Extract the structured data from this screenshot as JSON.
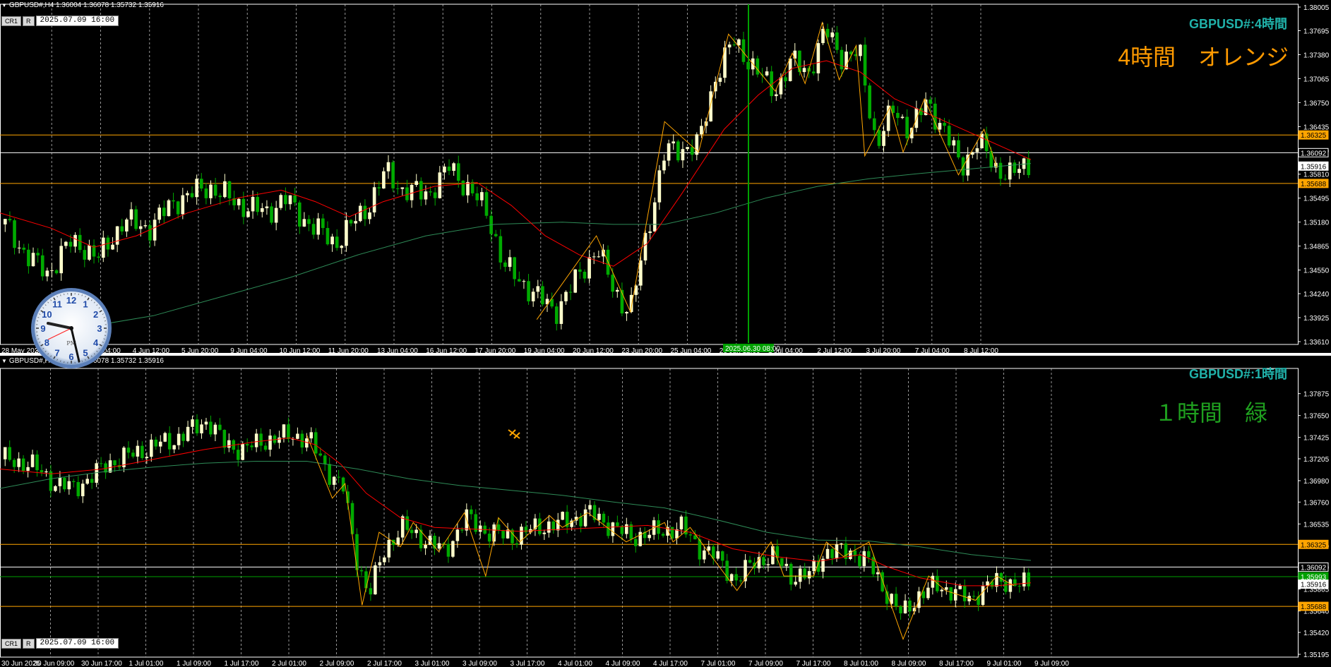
{
  "colors": {
    "background": "#000000",
    "bull_candle": "#ffffcc",
    "bear_candle": "#00aa00",
    "ma_fast": "#ff0000",
    "ma_slow": "#2e8b57",
    "zigzag": "#ffa500",
    "level_orange": "#ffa500",
    "level_white": "#ffffff",
    "cursor_line": "#00a000",
    "symbol_label_h4": "#20b2aa",
    "big_label_h4": "#ff9a00",
    "symbol_label_h1": "#20b2aa",
    "big_label_h1": "#1fa01f"
  },
  "toolbar": {
    "cr1_label": "CR1",
    "r_label": "R"
  },
  "chart_data": [
    {
      "type": "candlestick",
      "timeframe": "H4",
      "header": "GBPUSD#,H4  1.36004 1.36078 1.35732 1.35916",
      "date_box": "2025.07.09 16:00",
      "symbol_label": "GBPUSD#:4時間",
      "big_label": "4時間　オレンジ",
      "ylim": [
        1.3361,
        1.38005
      ],
      "price_ticks": [
        "1.38005",
        "1.37695",
        "1.37380",
        "1.37065",
        "1.36750",
        "1.36435",
        "1.36120",
        "1.35810",
        "1.35495",
        "1.35180",
        "1.34865",
        "1.34550",
        "1.34240",
        "1.33925",
        "1.33610"
      ],
      "price_tags": [
        {
          "value": "1.36325",
          "kind": "orange"
        },
        {
          "value": "1.36092",
          "kind": "white"
        },
        {
          "value": "1.35916",
          "kind": "current"
        },
        {
          "value": "1.35688",
          "kind": "orange"
        }
      ],
      "time_ticks": [
        "28 May 2025",
        "30 May 20:00",
        "3 Jun 04:00",
        "4 Jun 12:00",
        "5 Jun 20:00",
        "9 Jun 04:00",
        "10 Jun 12:00",
        "11 Jun 20:00",
        "13 Jun 04:00",
        "16 Jun 12:00",
        "17 Jun 20:00",
        "19 Jun 04:00",
        "20 Jun 12:00",
        "23 Jun 20:00",
        "25 Jun 04:00",
        "26 Jun 12:00",
        "1 Jul 04:00",
        "2 Jul 12:00",
        "3 Jul 20:00",
        "7 Jul 04:00",
        "8 Jul 12:00"
      ],
      "cursor_time": "2025.06.30 08:00",
      "levels": [
        1.36325,
        1.36092,
        1.35688
      ],
      "anchors": [
        [
          0,
          1.3515
        ],
        [
          0.025,
          1.3475
        ],
        [
          0.05,
          1.345
        ],
        [
          0.075,
          1.349
        ],
        [
          0.09,
          1.3488
        ],
        [
          0.11,
          1.347
        ],
        [
          0.14,
          1.352
        ],
        [
          0.17,
          1.351
        ],
        [
          0.2,
          1.3545
        ],
        [
          0.24,
          1.3565
        ],
        [
          0.28,
          1.354
        ],
        [
          0.31,
          1.353
        ],
        [
          0.33,
          1.355
        ],
        [
          0.35,
          1.3525
        ],
        [
          0.39,
          1.349
        ],
        [
          0.43,
          1.354
        ],
        [
          0.45,
          1.3585
        ],
        [
          0.47,
          1.356
        ],
        [
          0.5,
          1.3555
        ],
        [
          0.525,
          1.359
        ],
        [
          0.55,
          1.356
        ],
        [
          0.57,
          1.353
        ],
        [
          0.59,
          1.346
        ],
        [
          0.61,
          1.344
        ],
        [
          0.63,
          1.342
        ],
        [
          0.65,
          1.34
        ],
        [
          0.68,
          1.345
        ],
        [
          0.7,
          1.3485
        ],
        [
          0.715,
          1.344
        ],
        [
          0.73,
          1.341
        ],
        [
          0.74,
          1.3405
        ],
        [
          0.76,
          1.351
        ],
        [
          0.78,
          1.361
        ],
        [
          0.8,
          1.3615
        ],
        [
          0.82,
          1.362
        ],
        [
          0.84,
          1.371
        ],
        [
          0.86,
          1.3755
        ],
        [
          0.88,
          1.373
        ],
        [
          0.9,
          1.37
        ],
        [
          0.91,
          1.369
        ],
        [
          0.93,
          1.373
        ],
        [
          0.95,
          1.3715
        ],
        [
          0.97,
          1.377
        ],
        [
          0.99,
          1.3735
        ],
        [
          1.01,
          1.374
        ],
        [
          1.03,
          1.362
        ],
        [
          1.05,
          1.3665
        ],
        [
          1.07,
          1.364
        ],
        [
          1.09,
          1.3675
        ],
        [
          1.11,
          1.364
        ],
        [
          1.13,
          1.359
        ],
        [
          1.15,
          1.3625
        ],
        [
          1.17,
          1.359
        ],
        [
          1.19,
          1.358
        ],
        [
          1.21,
          1.3595
        ]
      ],
      "zigzag": [
        [
          0.63,
          1.339
        ],
        [
          0.7,
          1.35
        ],
        [
          0.74,
          1.34
        ],
        [
          0.78,
          1.365
        ],
        [
          0.82,
          1.361
        ],
        [
          0.855,
          1.3765
        ],
        [
          0.91,
          1.369
        ],
        [
          0.93,
          1.374
        ],
        [
          0.945,
          1.37
        ],
        [
          0.965,
          1.378
        ],
        [
          0.985,
          1.3705
        ],
        [
          1.005,
          1.375
        ],
        [
          1.015,
          1.3605
        ],
        [
          1.045,
          1.367
        ],
        [
          1.06,
          1.361
        ],
        [
          1.085,
          1.368
        ],
        [
          1.125,
          1.358
        ],
        [
          1.155,
          1.364
        ],
        [
          1.17,
          1.359
        ]
      ],
      "ma_fast": [
        [
          0,
          1.353
        ],
        [
          0.06,
          1.351
        ],
        [
          0.11,
          1.3485
        ],
        [
          0.16,
          1.35
        ],
        [
          0.22,
          1.353
        ],
        [
          0.28,
          1.355
        ],
        [
          0.33,
          1.356
        ],
        [
          0.37,
          1.3545
        ],
        [
          0.41,
          1.3525
        ],
        [
          0.45,
          1.3545
        ],
        [
          0.51,
          1.3565
        ],
        [
          0.56,
          1.357
        ],
        [
          0.6,
          1.354
        ],
        [
          0.64,
          1.35
        ],
        [
          0.68,
          1.3475
        ],
        [
          0.72,
          1.346
        ],
        [
          0.76,
          1.349
        ],
        [
          0.8,
          1.3555
        ],
        [
          0.85,
          1.364
        ],
        [
          0.89,
          1.3685
        ],
        [
          0.93,
          1.372
        ],
        [
          0.97,
          1.373
        ],
        [
          1.01,
          1.3715
        ],
        [
          1.05,
          1.368
        ],
        [
          1.1,
          1.3655
        ],
        [
          1.15,
          1.363
        ],
        [
          1.21,
          1.36
        ]
      ],
      "ma_slow": [
        [
          0.1,
          1.338
        ],
        [
          0.18,
          1.3395
        ],
        [
          0.26,
          1.342
        ],
        [
          0.34,
          1.3445
        ],
        [
          0.42,
          1.3475
        ],
        [
          0.5,
          1.35
        ],
        [
          0.58,
          1.3515
        ],
        [
          0.66,
          1.3518
        ],
        [
          0.72,
          1.3515
        ],
        [
          0.78,
          1.3515
        ],
        [
          0.84,
          1.353
        ],
        [
          0.9,
          1.355
        ],
        [
          0.96,
          1.3565
        ],
        [
          1.02,
          1.3575
        ],
        [
          1.08,
          1.3582
        ],
        [
          1.14,
          1.3588
        ],
        [
          1.21,
          1.3595
        ]
      ]
    },
    {
      "type": "candlestick",
      "timeframe": "H1",
      "header": "GBPUSD#,H1  1.36004 1.36078 1.35732 1.35916",
      "date_box": "2025.07.09 16:00",
      "symbol_label": "GBPUSD#:1時間",
      "big_label": "１時間　緑",
      "ylim": [
        1.35195,
        1.38105
      ],
      "price_ticks": [
        "1.37875",
        "1.37650",
        "1.37425",
        "1.37205",
        "1.36980",
        "1.36760",
        "1.36535",
        "1.36310",
        "1.36090",
        "1.35865",
        "1.35640",
        "1.35420",
        "1.35195"
      ],
      "price_tags": [
        {
          "value": "1.36325",
          "kind": "orange"
        },
        {
          "value": "1.36092",
          "kind": "white"
        },
        {
          "value": "1.35993",
          "kind": "green"
        },
        {
          "value": "1.35916",
          "kind": "current"
        },
        {
          "value": "1.35688",
          "kind": "orange"
        }
      ],
      "time_ticks": [
        "30 Jun 2025",
        "30 Jun 09:00",
        "30 Jun 17:00",
        "1 Jul 01:00",
        "1 Jul 09:00",
        "1 Jul 17:00",
        "2 Jul 01:00",
        "2 Jul 09:00",
        "2 Jul 17:00",
        "3 Jul 01:00",
        "3 Jul 09:00",
        "3 Jul 17:00",
        "4 Jul 01:00",
        "4 Jul 09:00",
        "4 Jul 17:00",
        "7 Jul 01:00",
        "7 Jul 09:00",
        "7 Jul 17:00",
        "8 Jul 01:00",
        "8 Jul 09:00",
        "8 Jul 17:00",
        "9 Jul 01:00",
        "9 Jul 09:00"
      ],
      "levels": [
        1.36325,
        1.36092,
        1.35993,
        1.35688
      ],
      "anchors": [
        [
          0,
          1.372
        ],
        [
          0.03,
          1.3715
        ],
        [
          0.06,
          1.3695
        ],
        [
          0.08,
          1.369
        ],
        [
          0.1,
          1.37
        ],
        [
          0.12,
          1.3715
        ],
        [
          0.15,
          1.3725
        ],
        [
          0.18,
          1.3735
        ],
        [
          0.2,
          1.374
        ],
        [
          0.24,
          1.376
        ],
        [
          0.26,
          1.3735
        ],
        [
          0.28,
          1.373
        ],
        [
          0.31,
          1.374
        ],
        [
          0.34,
          1.3745
        ],
        [
          0.36,
          1.374
        ],
        [
          0.38,
          1.371
        ],
        [
          0.4,
          1.369
        ],
        [
          0.415,
          1.362
        ],
        [
          0.43,
          1.358
        ],
        [
          0.45,
          1.363
        ],
        [
          0.47,
          1.365
        ],
        [
          0.49,
          1.364
        ],
        [
          0.52,
          1.3625
        ],
        [
          0.545,
          1.366
        ],
        [
          0.57,
          1.3645
        ],
        [
          0.6,
          1.364
        ],
        [
          0.63,
          1.365
        ],
        [
          0.66,
          1.3655
        ],
        [
          0.69,
          1.3665
        ],
        [
          0.72,
          1.365
        ],
        [
          0.74,
          1.364
        ],
        [
          0.77,
          1.3645
        ],
        [
          0.8,
          1.365
        ],
        [
          0.82,
          1.363
        ],
        [
          0.84,
          1.362
        ],
        [
          0.865,
          1.3595
        ],
        [
          0.885,
          1.3615
        ],
        [
          0.91,
          1.362
        ],
        [
          0.93,
          1.36
        ],
        [
          0.95,
          1.36
        ],
        [
          0.97,
          1.3625
        ],
        [
          1.0,
          1.3625
        ],
        [
          1.02,
          1.3615
        ],
        [
          1.04,
          1.3585
        ],
        [
          1.06,
          1.356
        ],
        [
          1.08,
          1.358
        ],
        [
          1.1,
          1.359
        ],
        [
          1.12,
          1.3585
        ],
        [
          1.14,
          1.3575
        ],
        [
          1.16,
          1.359
        ],
        [
          1.18,
          1.3595
        ],
        [
          1.21,
          1.359
        ]
      ],
      "zigzag": [
        [
          0.36,
          1.3745
        ],
        [
          0.39,
          1.368
        ],
        [
          0.405,
          1.3695
        ],
        [
          0.425,
          1.357
        ],
        [
          0.445,
          1.3645
        ],
        [
          0.47,
          1.363
        ],
        [
          0.485,
          1.3655
        ],
        [
          0.515,
          1.3625
        ],
        [
          0.545,
          1.3665
        ],
        [
          0.57,
          1.36
        ],
        [
          0.585,
          1.366
        ],
        [
          0.61,
          1.3635
        ],
        [
          0.645,
          1.3662
        ],
        [
          0.66,
          1.365
        ],
        [
          0.69,
          1.3665
        ],
        [
          0.735,
          1.3635
        ],
        [
          0.78,
          1.3655
        ],
        [
          0.79,
          1.3635
        ],
        [
          0.81,
          1.365
        ],
        [
          0.865,
          1.3585
        ],
        [
          0.905,
          1.3635
        ],
        [
          0.92,
          1.36
        ],
        [
          0.955,
          1.36
        ],
        [
          0.97,
          1.3635
        ],
        [
          0.99,
          1.362
        ],
        [
          1.02,
          1.3635
        ],
        [
          1.06,
          1.3535
        ],
        [
          1.09,
          1.36
        ],
        [
          1.11,
          1.3585
        ],
        [
          1.145,
          1.3575
        ],
        [
          1.17,
          1.36
        ],
        [
          1.19,
          1.359
        ]
      ],
      "ma_fast": [
        [
          0,
          1.371
        ],
        [
          0.06,
          1.3705
        ],
        [
          0.12,
          1.371
        ],
        [
          0.18,
          1.372
        ],
        [
          0.24,
          1.373
        ],
        [
          0.3,
          1.3738
        ],
        [
          0.34,
          1.3742
        ],
        [
          0.37,
          1.3735
        ],
        [
          0.4,
          1.3715
        ],
        [
          0.43,
          1.3685
        ],
        [
          0.47,
          1.366
        ],
        [
          0.51,
          1.365
        ],
        [
          0.56,
          1.3648
        ],
        [
          0.61,
          1.3646
        ],
        [
          0.66,
          1.3648
        ],
        [
          0.71,
          1.365
        ],
        [
          0.76,
          1.3652
        ],
        [
          0.81,
          1.3645
        ],
        [
          0.86,
          1.3628
        ],
        [
          0.91,
          1.362
        ],
        [
          0.96,
          1.3615
        ],
        [
          1.01,
          1.3622
        ],
        [
          1.04,
          1.361
        ],
        [
          1.08,
          1.3598
        ],
        [
          1.13,
          1.359
        ],
        [
          1.17,
          1.359
        ],
        [
          1.21,
          1.3593
        ]
      ],
      "ma_slow": [
        [
          0,
          1.369
        ],
        [
          0.06,
          1.37
        ],
        [
          0.12,
          1.3707
        ],
        [
          0.18,
          1.3712
        ],
        [
          0.24,
          1.3716
        ],
        [
          0.3,
          1.3718
        ],
        [
          0.36,
          1.3718
        ],
        [
          0.42,
          1.371
        ],
        [
          0.48,
          1.37
        ],
        [
          0.54,
          1.3693
        ],
        [
          0.6,
          1.3688
        ],
        [
          0.66,
          1.3683
        ],
        [
          0.72,
          1.3676
        ],
        [
          0.78,
          1.367
        ],
        [
          0.84,
          1.3658
        ],
        [
          0.9,
          1.3645
        ],
        [
          0.96,
          1.3637
        ],
        [
          1.02,
          1.3636
        ],
        [
          1.08,
          1.363
        ],
        [
          1.14,
          1.3622
        ],
        [
          1.21,
          1.3616
        ]
      ]
    }
  ]
}
